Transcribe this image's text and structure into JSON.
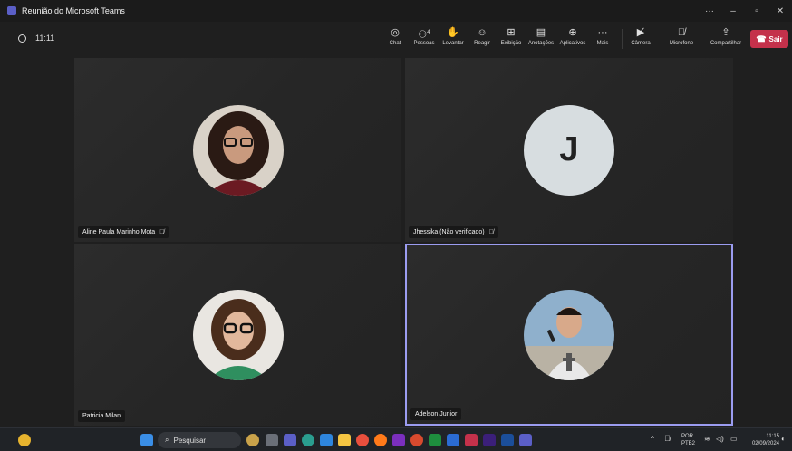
{
  "window": {
    "title": "Reunião do Microsoft Teams",
    "controls": [
      "···",
      "–",
      "▫",
      "✕"
    ]
  },
  "meeting": {
    "elapsed": "11:11"
  },
  "toolbar": {
    "chat": {
      "label": "Chat",
      "icon": "chat-icon"
    },
    "people": {
      "label": "Pessoas",
      "icon": "people-icon",
      "count": "4"
    },
    "raise": {
      "label": "Levantar",
      "icon": "hand-icon"
    },
    "react": {
      "label": "Reagir",
      "icon": "smile-icon"
    },
    "view": {
      "label": "Exibição",
      "icon": "grid-icon"
    },
    "notes": {
      "label": "Anotações",
      "icon": "notes-icon"
    },
    "apps": {
      "label": "Aplicativos",
      "icon": "plus-icon"
    },
    "more": {
      "label": "Mais",
      "icon": "ellipsis-icon"
    },
    "camera": {
      "label": "Câmera",
      "icon": "camera-off-icon"
    },
    "mic": {
      "label": "Microfone",
      "icon": "mic-off-icon"
    },
    "share": {
      "label": "Compartilhar",
      "icon": "share-icon"
    },
    "leave": {
      "label": "Sair",
      "icon": "phone-icon",
      "color": "#c4314b"
    }
  },
  "participants": [
    {
      "name": "Aline Paula Marinho Mota",
      "muted": true
    },
    {
      "name": "Jhessika (Não verificado)",
      "muted": true,
      "initial": "J"
    },
    {
      "name": "Patricia Milan",
      "muted": false
    },
    {
      "name": "Adelson Junior",
      "muted": false,
      "speaking": true
    }
  ],
  "taskbar": {
    "search_placeholder": "Pesquisar",
    "language": "POR",
    "layout": "PTB2",
    "time": "11:15",
    "date": "02/09/2024"
  }
}
